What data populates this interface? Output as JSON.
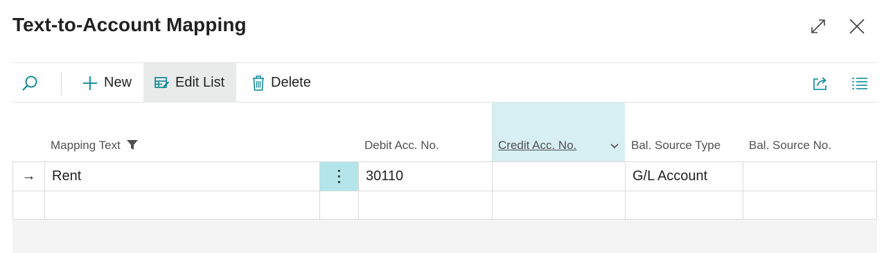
{
  "page": {
    "title": "Text-to-Account Mapping"
  },
  "window": {
    "expand_icon": "expand-icon",
    "close_icon": "close-icon"
  },
  "toolbar": {
    "search_icon": "search-icon",
    "new_label": "New",
    "edit_list_label": "Edit List",
    "delete_label": "Delete",
    "share_icon": "share-icon",
    "list_icon": "list-view-icon"
  },
  "columns": {
    "mapping_text": "Mapping Text",
    "debit_acc_no": "Debit Acc. No.",
    "credit_acc_no": "Credit Acc. No.",
    "bal_source_type": "Bal. Source Type",
    "bal_source_no": "Bal. Source No."
  },
  "rows": [
    {
      "indicator": "→",
      "mapping_text": "Rent",
      "menu": "⋮",
      "debit_acc_no": "30110",
      "credit_acc_no": "",
      "bal_source_type": "G/L Account",
      "bal_source_no": ""
    },
    {
      "indicator": "",
      "mapping_text": "",
      "menu": "",
      "debit_acc_no": "",
      "credit_acc_no": "",
      "bal_source_type": "",
      "bal_source_no": ""
    }
  ],
  "colors": {
    "accent": "#00838f",
    "active_column": "#d7eef2",
    "row_menu": "#b3e5ea"
  }
}
